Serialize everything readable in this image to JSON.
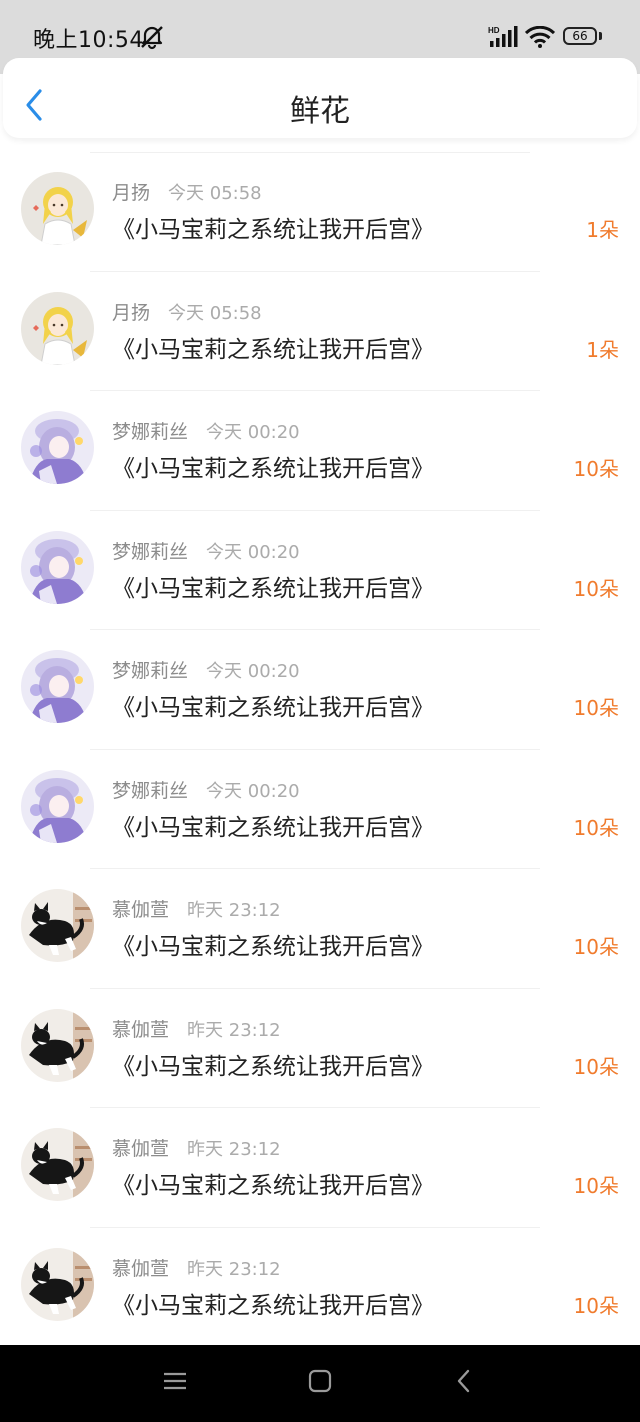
{
  "status_bar": {
    "time": "晚上10:54",
    "battery": "66",
    "icons": [
      "mute-icon",
      "hd-signal-icon",
      "wifi-icon",
      "battery-icon"
    ]
  },
  "header": {
    "title": "鲜花",
    "back_icon": "chevron-left-icon",
    "accent_color": "#2a8de8"
  },
  "colors": {
    "count": "#f07b2d",
    "name": "#8c8c8c",
    "time": "#ababab"
  },
  "items": [
    {
      "name": "月扬",
      "time": "今天 05:58",
      "book": "《小马宝莉之系统让我开后宫》",
      "count": "1朵",
      "avatar": "blonde-girl-avatar"
    },
    {
      "name": "月扬",
      "time": "今天 05:58",
      "book": "《小马宝莉之系统让我开后宫》",
      "count": "1朵",
      "avatar": "blonde-girl-avatar"
    },
    {
      "name": "梦娜莉丝",
      "time": "今天 00:20",
      "book": "《小马宝莉之系统让我开后宫》",
      "count": "10朵",
      "avatar": "purple-anime-girl-avatar"
    },
    {
      "name": "梦娜莉丝",
      "time": "今天 00:20",
      "book": "《小马宝莉之系统让我开后宫》",
      "count": "10朵",
      "avatar": "purple-anime-girl-avatar"
    },
    {
      "name": "梦娜莉丝",
      "time": "今天 00:20",
      "book": "《小马宝莉之系统让我开后宫》",
      "count": "10朵",
      "avatar": "purple-anime-girl-avatar"
    },
    {
      "name": "梦娜莉丝",
      "time": "今天 00:20",
      "book": "《小马宝莉之系统让我开后宫》",
      "count": "10朵",
      "avatar": "purple-anime-girl-avatar"
    },
    {
      "name": "慕伽萱",
      "time": "昨天 23:12",
      "book": "《小马宝莉之系统让我开后宫》",
      "count": "10朵",
      "avatar": "black-white-cat-avatar"
    },
    {
      "name": "慕伽萱",
      "time": "昨天 23:12",
      "book": "《小马宝莉之系统让我开后宫》",
      "count": "10朵",
      "avatar": "black-white-cat-avatar"
    },
    {
      "name": "慕伽萱",
      "time": "昨天 23:12",
      "book": "《小马宝莉之系统让我开后宫》",
      "count": "10朵",
      "avatar": "black-white-cat-avatar"
    },
    {
      "name": "慕伽萱",
      "time": "昨天 23:12",
      "book": "《小马宝莉之系统让我开后宫》",
      "count": "10朵",
      "avatar": "black-white-cat-avatar"
    }
  ],
  "system_nav": {
    "icons": [
      "menu-icon",
      "home-icon",
      "back-icon"
    ]
  }
}
